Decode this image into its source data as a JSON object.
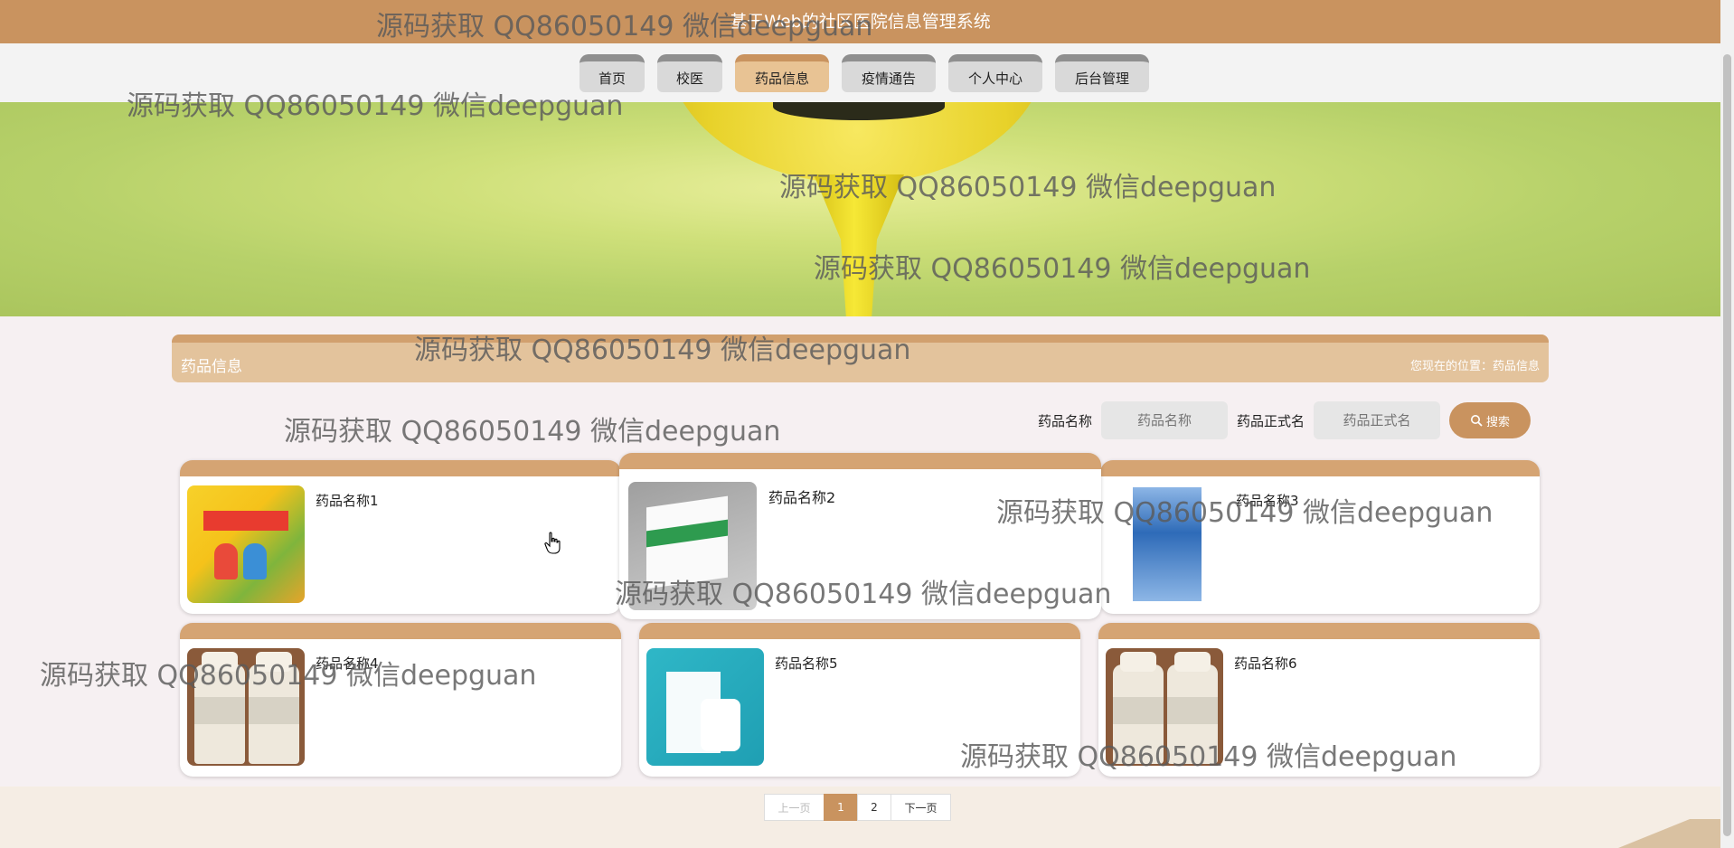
{
  "app_title": "基于Web的社区医院信息管理系统",
  "nav": {
    "items": [
      {
        "label": "首页"
      },
      {
        "label": "校医"
      },
      {
        "label": "药品信息"
      },
      {
        "label": "疫情通告"
      },
      {
        "label": "个人中心"
      },
      {
        "label": "后台管理"
      }
    ]
  },
  "section": {
    "title": "药品信息",
    "breadcrumb": "您现在的位置：药品信息"
  },
  "search": {
    "name_label": "药品名称",
    "name_placeholder": "药品名称",
    "formal_label": "药品正式名",
    "formal_placeholder": "药品正式名",
    "button_label": "搜索"
  },
  "products": [
    {
      "name": "药品名称1"
    },
    {
      "name": "药品名称2"
    },
    {
      "name": "药品名称3"
    },
    {
      "name": "药品名称4"
    },
    {
      "name": "药品名称5"
    },
    {
      "name": "药品名称6"
    }
  ],
  "pagination": {
    "prev": "上一页",
    "pages": [
      "1",
      "2"
    ],
    "current": "1",
    "next": "下一页"
  },
  "watermark": "源码获取 QQ86050149 微信deepguan",
  "colors": {
    "brand": "#c9935f",
    "card_top": "#d5a473",
    "title_bar": "#e3c39c"
  }
}
